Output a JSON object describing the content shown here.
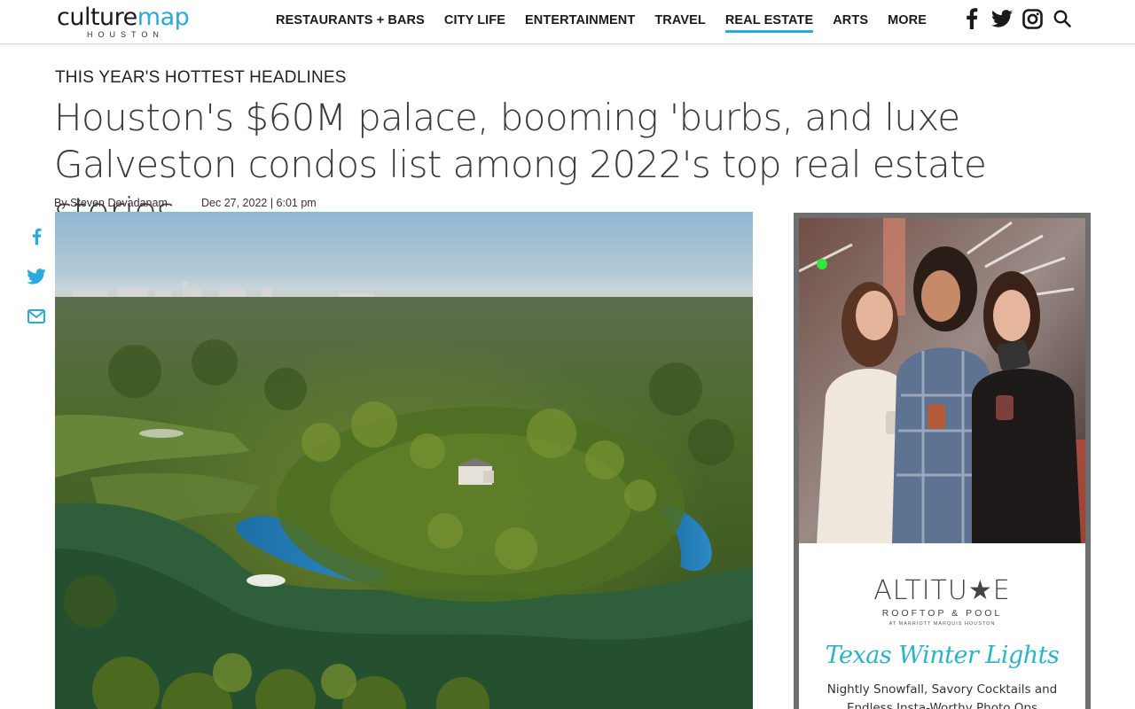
{
  "site": {
    "logo_main_a": "culture",
    "logo_main_b": "map",
    "logo_sub": "HOUSTON",
    "accent_color": "#2aa9dc"
  },
  "nav": {
    "items": [
      {
        "label": "RESTAURANTS + BARS",
        "active": false
      },
      {
        "label": "CITY LIFE",
        "active": false
      },
      {
        "label": "ENTERTAINMENT",
        "active": false
      },
      {
        "label": "TRAVEL",
        "active": false
      },
      {
        "label": "REAL ESTATE",
        "active": true
      },
      {
        "label": "ARTS",
        "active": false
      },
      {
        "label": "MORE",
        "active": false
      }
    ],
    "icons": [
      "facebook-icon",
      "twitter-icon",
      "instagram-icon",
      "search-icon"
    ]
  },
  "article": {
    "kicker": "THIS YEAR'S HOTTEST HEADLINES",
    "headline": "Houston's $60M palace, booming 'burbs, and luxe Galveston condos list among 2022's top real estate stories",
    "author": "By Steven Devadanam",
    "date": "Dec 27, 2022 | 6:01 pm"
  },
  "share": {
    "icons": [
      "facebook-icon",
      "twitter-icon",
      "email-icon"
    ],
    "color": "#2aa9dc"
  },
  "ad": {
    "brand": "ALTITU★E",
    "brand_sub": "ROOFTOP & POOL",
    "brand_tiny": "AT MARRIOTT MARQUIS HOUSTON",
    "script": "Texas Winter Lights",
    "copy_line1": "Nightly Snowfall, Savory Cocktails and",
    "copy_line2": "Endless Insta-Worthy Photo Ops",
    "script_color": "#2ab3c9"
  }
}
